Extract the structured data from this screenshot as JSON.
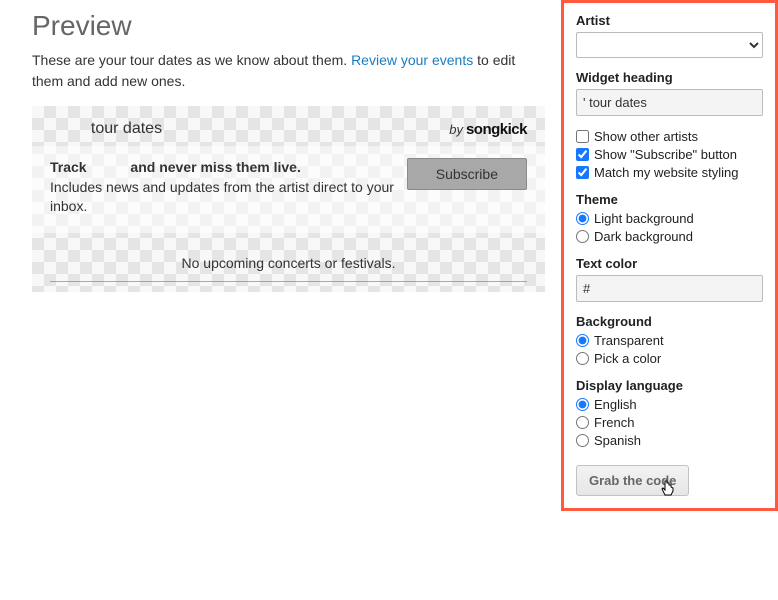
{
  "preview": {
    "title": "Preview",
    "desc_prefix": "These are your tour dates as we know about them. ",
    "desc_link": "Review your events",
    "desc_suffix": " to edit them and add new ones."
  },
  "widget": {
    "title": "tour dates",
    "by": "by",
    "brand": "songkick",
    "track_prefix": "Track ",
    "track_suffix": " and never miss them live.",
    "track_sub": "Includes news and updates from the artist direct to your inbox.",
    "subscribe": "Subscribe",
    "no_upcoming": "No upcoming concerts or festivals."
  },
  "panel": {
    "artist_label": "Artist",
    "artist_value": "",
    "heading_label": "Widget heading",
    "heading_value": "' tour dates",
    "check_other_artists": "Show other artists",
    "check_subscribe": "Show \"Subscribe\" button",
    "check_match": "Match my website styling",
    "theme_label": "Theme",
    "theme_light": "Light background",
    "theme_dark": "Dark background",
    "textcolor_label": "Text color",
    "textcolor_value": "#",
    "background_label": "Background",
    "bg_transparent": "Transparent",
    "bg_pick": "Pick a color",
    "language_label": "Display language",
    "lang_en": "English",
    "lang_fr": "French",
    "lang_es": "Spanish",
    "grab": "Grab the code"
  }
}
